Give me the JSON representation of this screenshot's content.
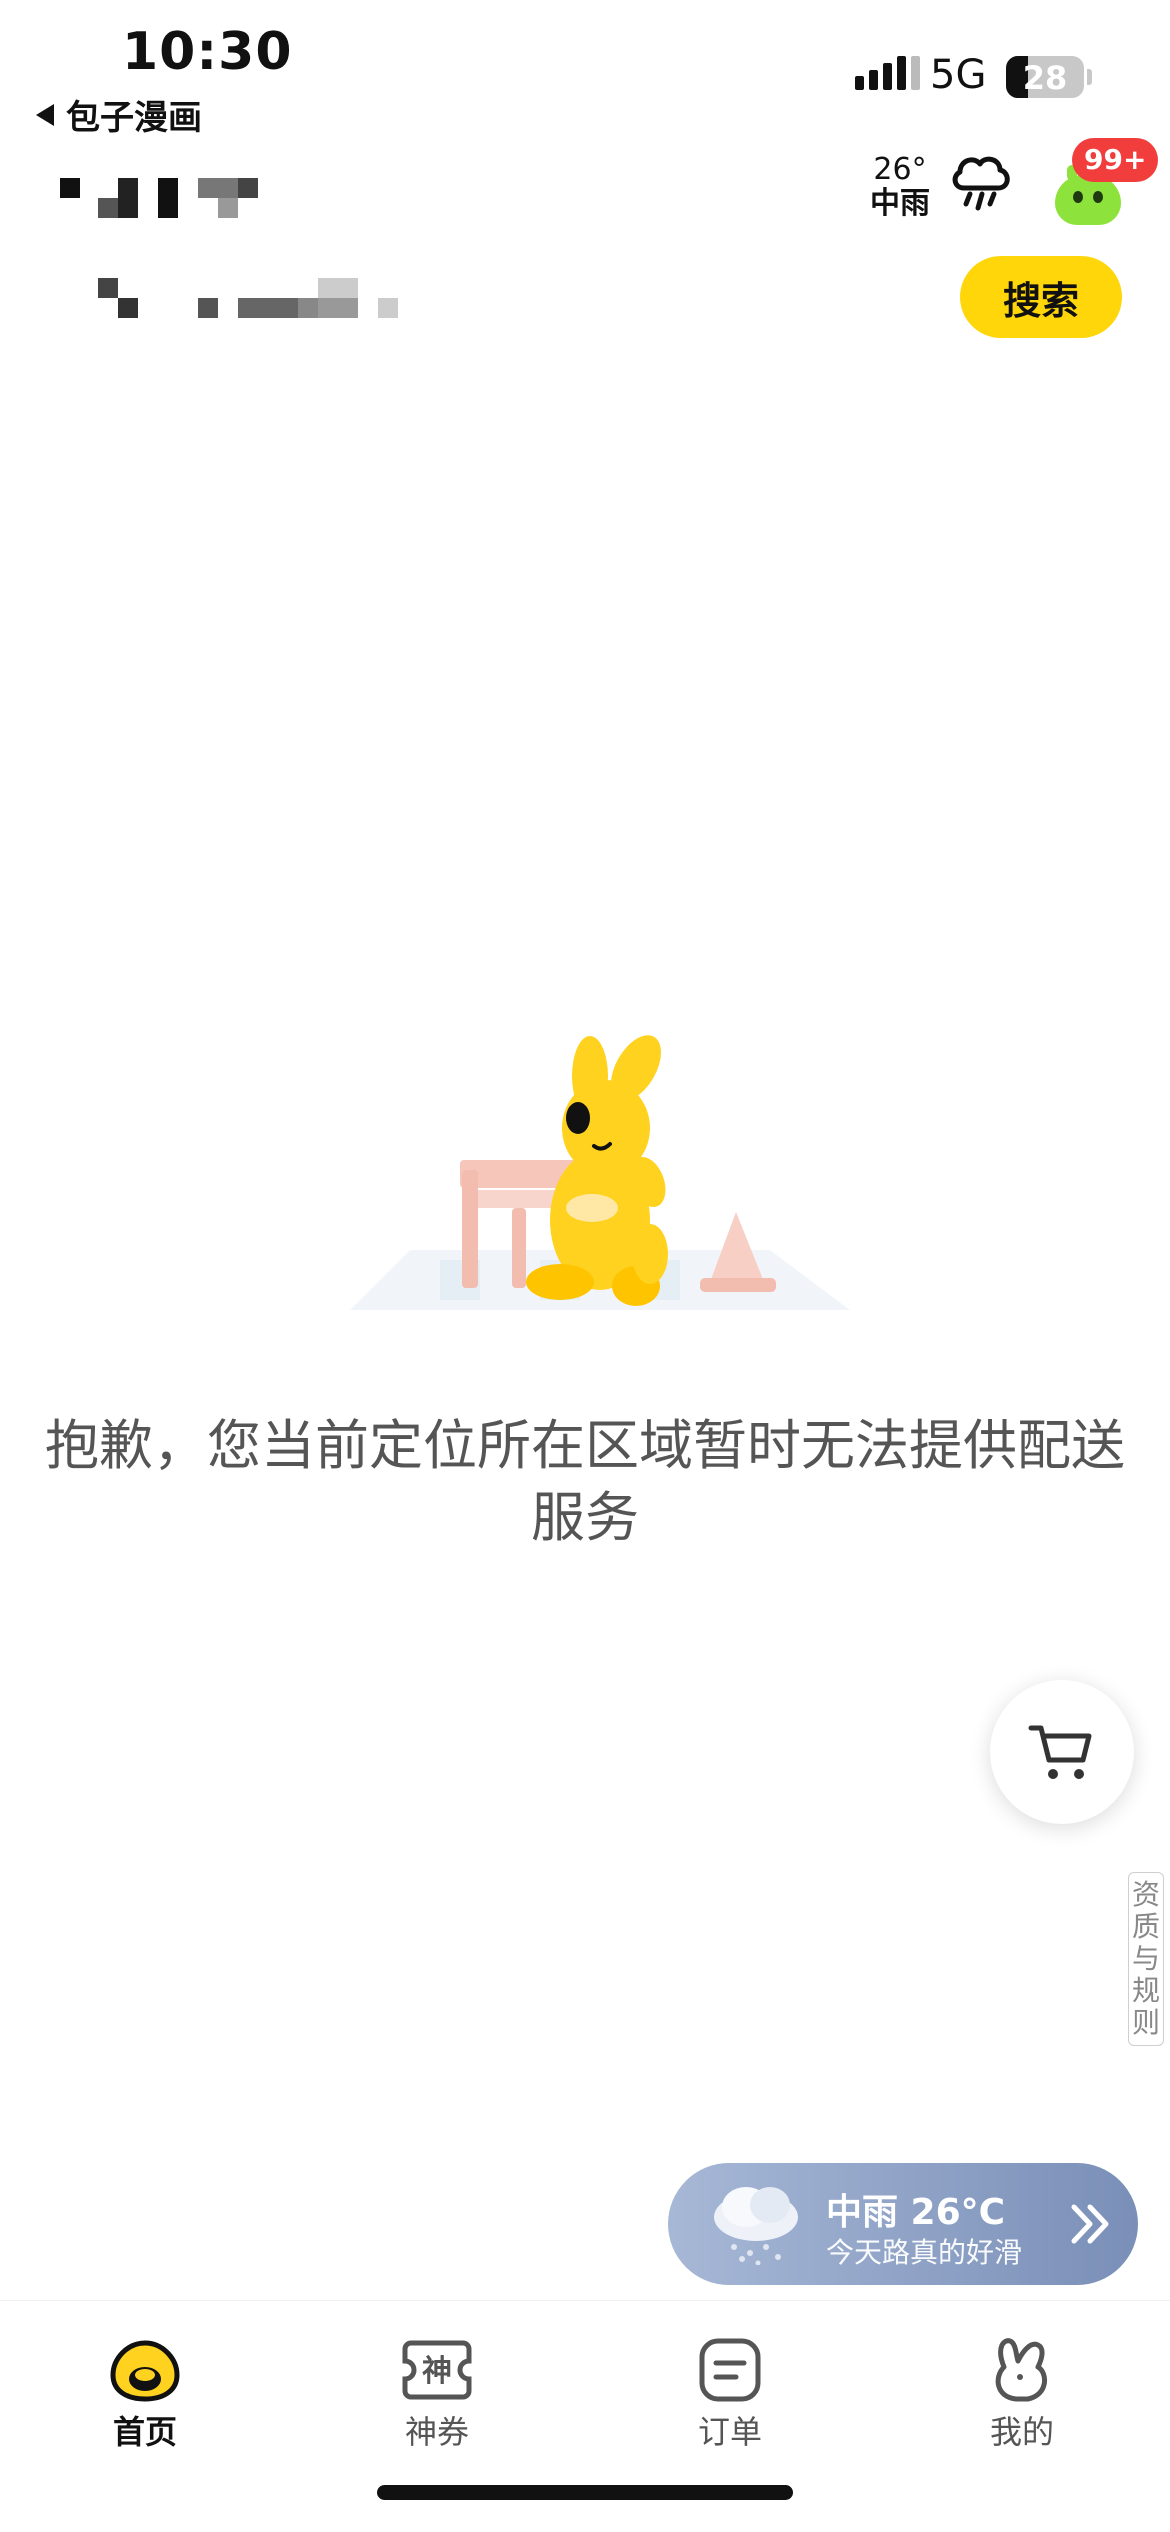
{
  "status_bar": {
    "time": "10:30",
    "back_app_label": "包子漫画",
    "network": "5G",
    "battery_level": "28",
    "battery_fraction": 0.28
  },
  "header": {
    "weather_temp": "26°",
    "weather_condition": "中雨",
    "weather_icon": "rain-cloud-icon",
    "notification_badge": "99+",
    "search_button_label": "搜索"
  },
  "main": {
    "empty_message": "抱歉，您当前定位所在区域暂时无法提供配送服务",
    "illustration": "construction-mascot-illustration"
  },
  "floating": {
    "cart_icon": "cart-icon",
    "rules_label": "资质与规则",
    "weather_banner_title": "中雨 26°C",
    "weather_banner_subtitle": "今天路真的好滑"
  },
  "tabbar": {
    "items": [
      {
        "label": "首页",
        "icon": "home-icon",
        "active": true
      },
      {
        "label": "神券",
        "icon": "coupon-icon",
        "active": false
      },
      {
        "label": "订单",
        "icon": "order-icon",
        "active": false
      },
      {
        "label": "我的",
        "icon": "profile-icon",
        "active": false
      }
    ]
  },
  "colors": {
    "accent_yellow": "#ffd60a",
    "badge_red": "#f23d3d",
    "banner_blue": "#7a8fb8"
  }
}
